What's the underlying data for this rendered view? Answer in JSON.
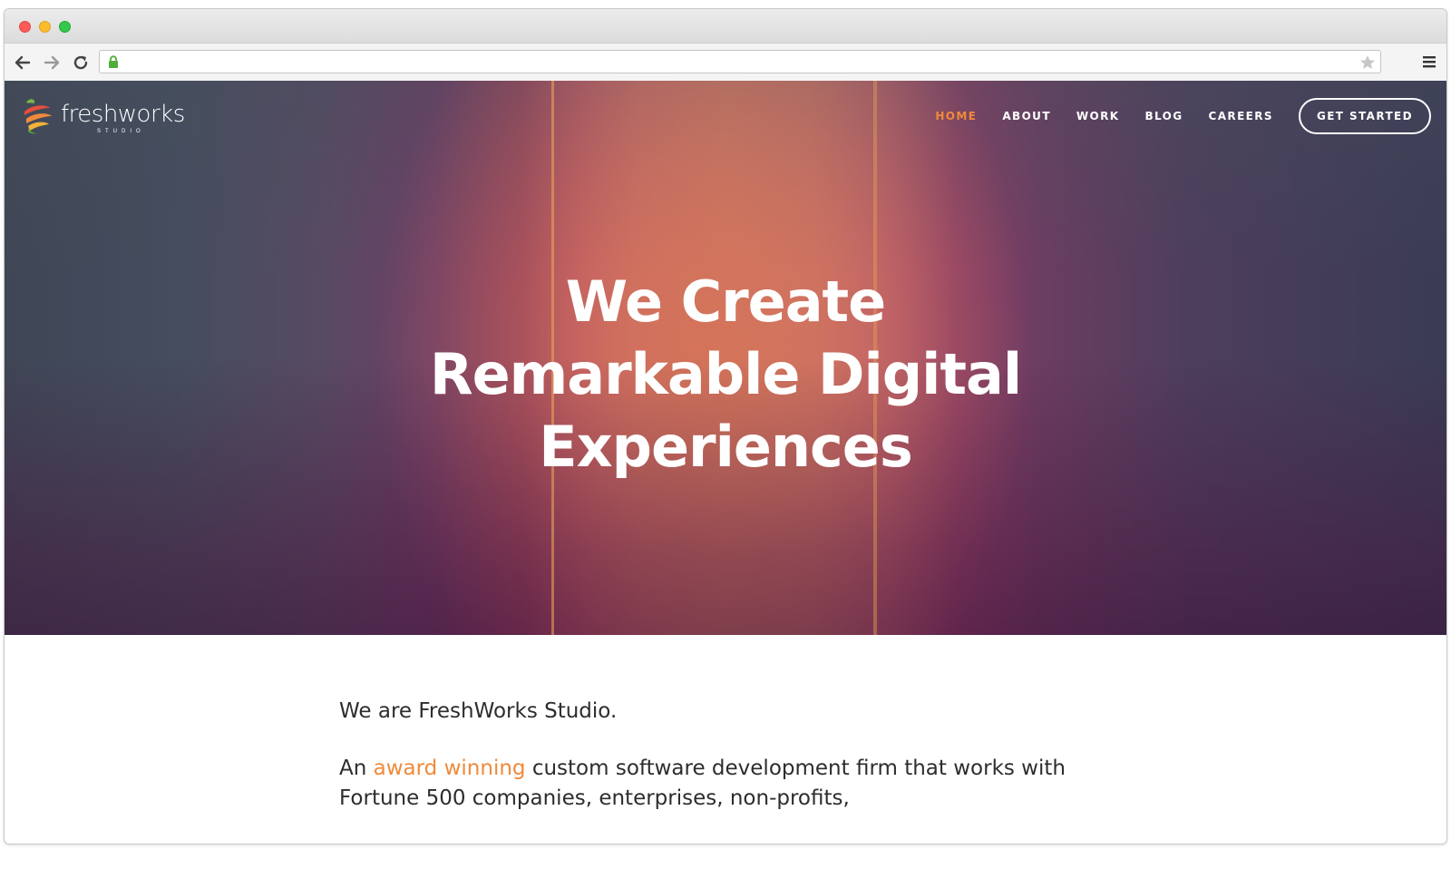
{
  "browser": {
    "url": ""
  },
  "site": {
    "logo_text": "freshworks",
    "logo_sub": "STUDIO",
    "nav": [
      {
        "label": "HOME",
        "active": true
      },
      {
        "label": "ABOUT",
        "active": false
      },
      {
        "label": "WORK",
        "active": false
      },
      {
        "label": "BLOG",
        "active": false
      },
      {
        "label": "CAREERS",
        "active": false
      }
    ],
    "cta_label": "GET STARTED",
    "headline": [
      "We Create",
      "Remarkable Digital",
      "Experiences"
    ],
    "intro": "We are FreshWorks Studio.",
    "body_prefix": "An ",
    "body_highlight": "award winning",
    "body_suffix": " custom software development firm that works with Fortune 500 companies, enterprises, non-profits,"
  },
  "colors": {
    "accent": "#f08a3a",
    "text_dark": "#2d2d2d"
  },
  "icons": {
    "back": "arrow-left-icon",
    "forward": "arrow-right-icon",
    "reload": "reload-icon",
    "lock": "lock-icon",
    "bookmark": "star-icon",
    "menu": "hamburger-icon"
  }
}
